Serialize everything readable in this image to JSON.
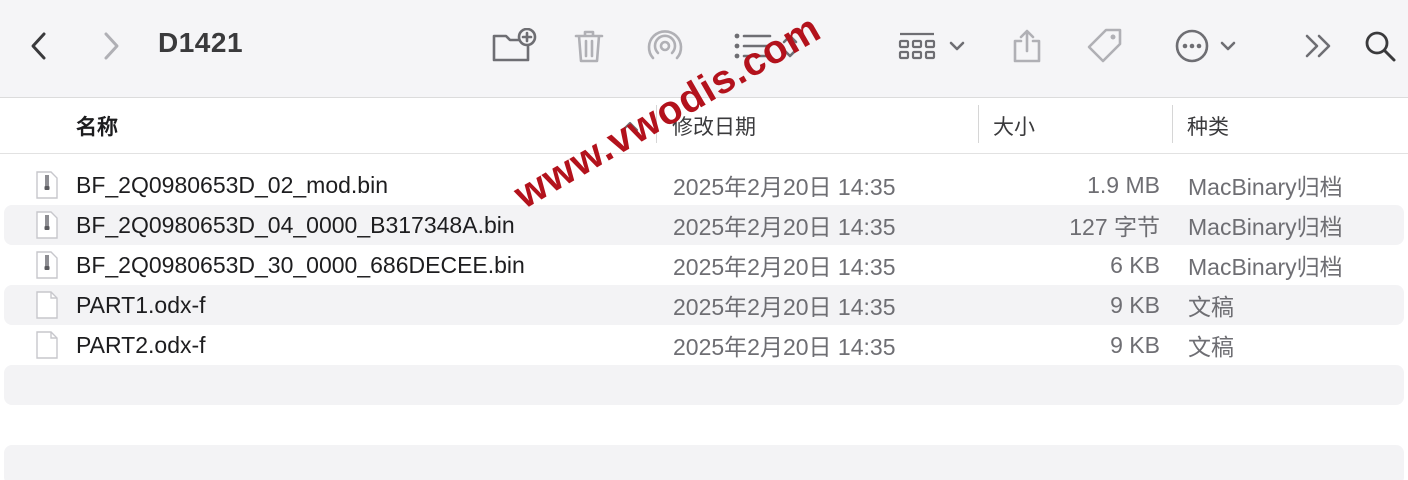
{
  "window": {
    "title": "D1421"
  },
  "toolbar": {
    "icons": [
      "chevron-left-icon",
      "chevron-right-icon",
      "new-folder-icon",
      "trash-icon",
      "airdrop-icon",
      "list-view-icon",
      "sort-updown-icon",
      "grid-view-icon",
      "chevron-down-icon",
      "share-icon",
      "tag-icon",
      "more-icon",
      "chevron-down-icon",
      "overflow-icon",
      "search-icon"
    ]
  },
  "columns": {
    "name": "名称",
    "date": "修改日期",
    "size": "大小",
    "kind": "种类"
  },
  "files": [
    {
      "name": "BF_2Q0980653D_02_mod.bin",
      "date": "2025年2月20日 14:35",
      "size": "1.9 MB",
      "kind": "MacBinary归档",
      "icon": "zip-file-icon"
    },
    {
      "name": "BF_2Q0980653D_04_0000_B317348A.bin",
      "date": "2025年2月20日 14:35",
      "size": "127 字节",
      "kind": "MacBinary归档",
      "icon": "zip-file-icon"
    },
    {
      "name": "BF_2Q0980653D_30_0000_686DECEE.bin",
      "date": "2025年2月20日 14:35",
      "size": "6 KB",
      "kind": "MacBinary归档",
      "icon": "zip-file-icon"
    },
    {
      "name": "PART1.odx-f",
      "date": "2025年2月20日 14:35",
      "size": "9 KB",
      "kind": "文稿",
      "icon": "document-icon"
    },
    {
      "name": "PART2.odx-f",
      "date": "2025年2月20日 14:35",
      "size": "9 KB",
      "kind": "文稿",
      "icon": "document-icon"
    }
  ],
  "watermark": "www.vwodis.com",
  "colors": {
    "toolbar_bg": "#f5f5f7",
    "stripe": "#f3f3f5",
    "watermark": "#b3121c",
    "icon": "#6e6e73"
  }
}
